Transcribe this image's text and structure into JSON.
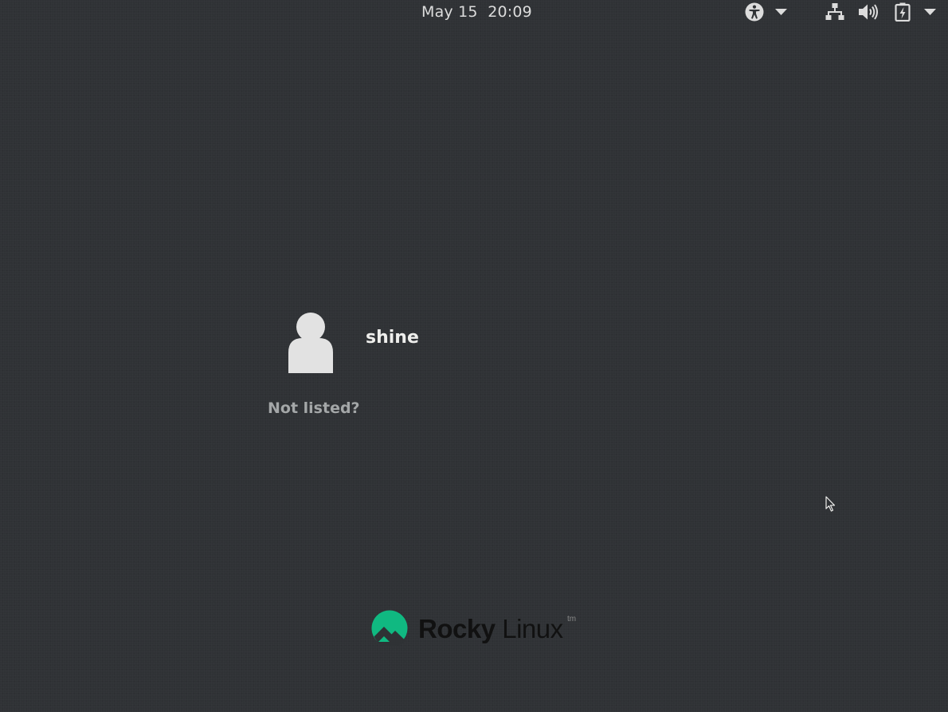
{
  "top_bar": {
    "date": "May 15",
    "time": "20:09",
    "icons": [
      "accessibility-icon",
      "network-icon",
      "volume-icon",
      "battery-icon",
      "chevron-down-icon"
    ]
  },
  "login": {
    "users": [
      {
        "name": "shine",
        "avatar_icon": "user-avatar-icon"
      }
    ],
    "not_listed_label": "Not listed?"
  },
  "branding": {
    "logo_word_1": "Rocky",
    "logo_word_2": "Linux",
    "logo_tm": "tm",
    "logo_color": "#10b981"
  },
  "colors": {
    "background": "#2f3235",
    "text_primary": "#eeeeec",
    "text_secondary": "#a4a7a8"
  }
}
